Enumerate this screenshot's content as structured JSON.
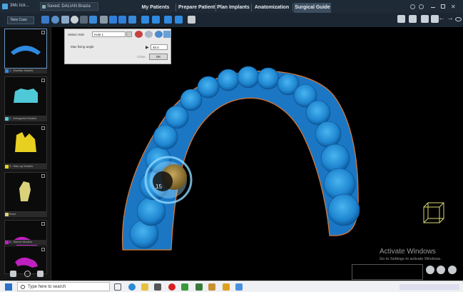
{
  "window": {
    "title": "3Mc lick...",
    "tab": "Saved: DALIAN Brazia"
  },
  "nav_tabs": [
    {
      "label": "My Patients"
    },
    {
      "label": "Prepare Patient"
    },
    {
      "label": "Plan Implants"
    },
    {
      "label": "Anatomization"
    },
    {
      "label": "Surgical Guide"
    }
  ],
  "active_tab": "Surgical Guide",
  "toolbar": {
    "new_case": "New Case"
  },
  "models": [
    {
      "label": "1.. Maxillar Models",
      "color": "#2f8ae0"
    },
    {
      "label": "2.. Antagonist Models",
      "color": "#4fc9d8"
    },
    {
      "label": "3.. Wax-up Models",
      "color": "#e8d020"
    },
    {
      "label": "Bone",
      "color": "#d9d27a"
    },
    {
      "label": "Nerve",
      "color": "#c020c0"
    },
    {
      "label": "5.. Sleeve Models",
      "color": "#c020c0"
    }
  ],
  "dialog": {
    "select_hole_label": "Select Hole",
    "select_hole_value": "Hole 1",
    "max_angle_label": "Max fixing angle",
    "angle_value": "45.0",
    "close_label": "Close",
    "ok_label": "OK"
  },
  "implant_label": "15",
  "activation": {
    "title": "Activate Windows",
    "subtitle": "Go to Settings to activate Windows."
  },
  "taskbar": {
    "search_placeholder": "Type here to search"
  }
}
